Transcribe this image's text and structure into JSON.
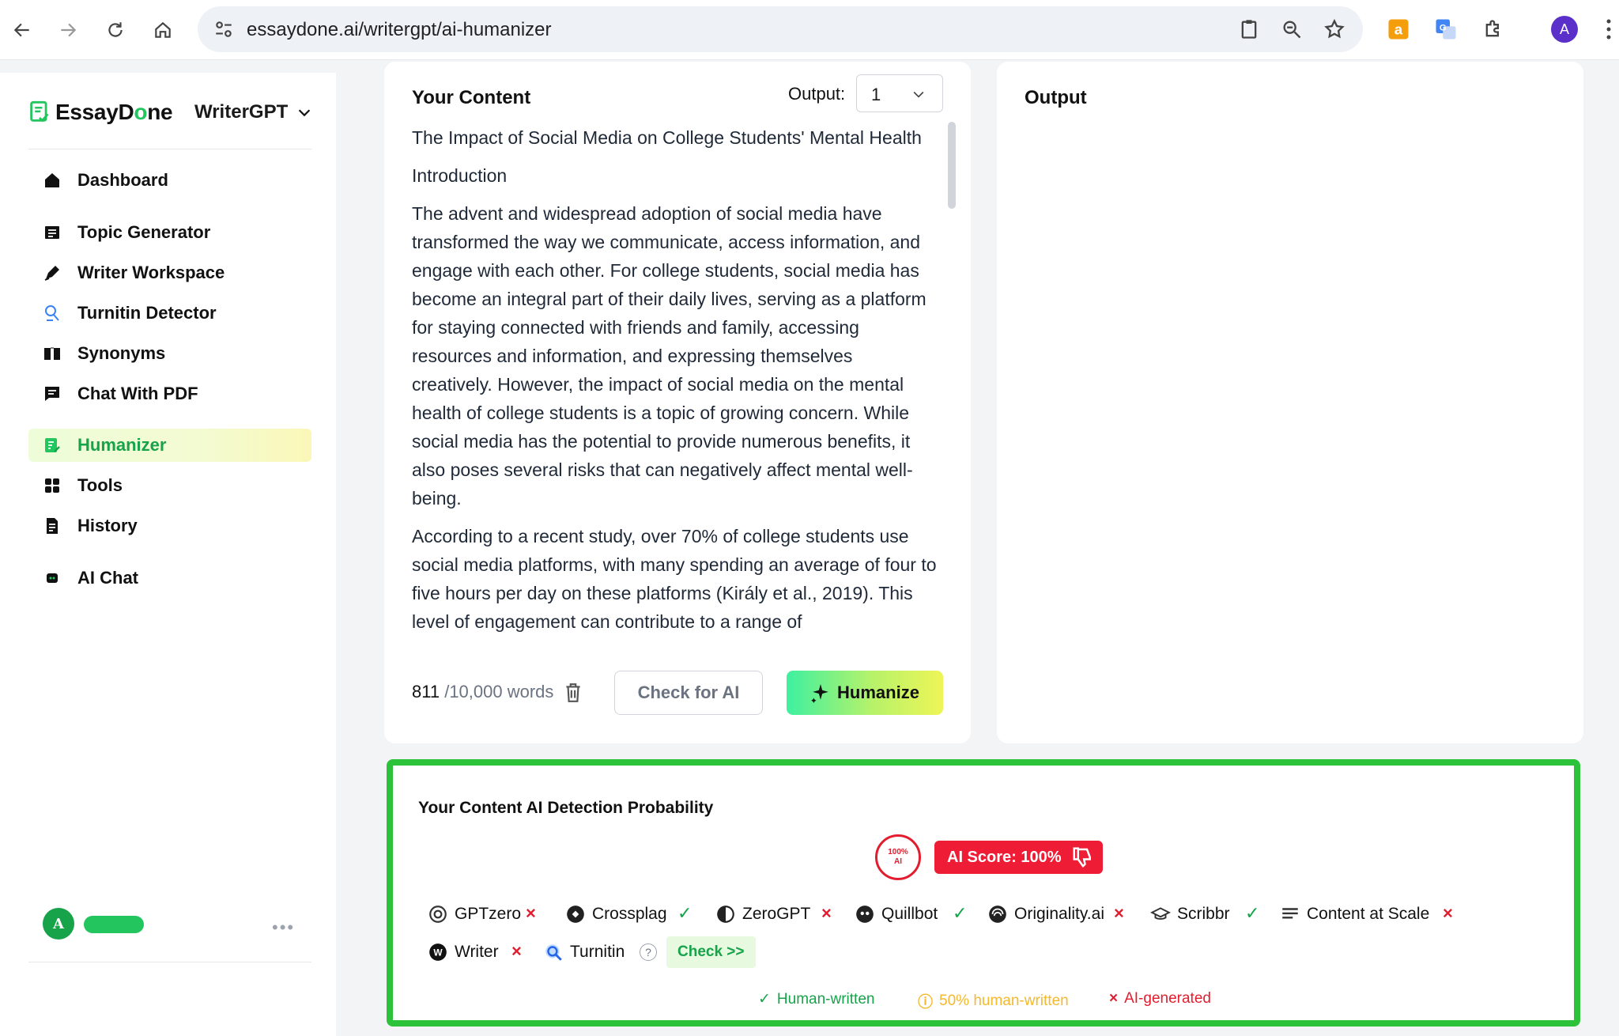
{
  "browser": {
    "url": "essaydone.ai/writergpt/ai-humanizer",
    "profile_initial": "A"
  },
  "sidebar": {
    "logo_prefix": "EssayD",
    "logo_o": "o",
    "logo_suffix": "ne",
    "product": "WriterGPT",
    "items": [
      {
        "label": "Dashboard",
        "icon": "home-icon"
      },
      {
        "label": "Topic Generator",
        "icon": "list-icon"
      },
      {
        "label": "Writer Workspace",
        "icon": "pen-icon"
      },
      {
        "label": "Turnitin Detector",
        "icon": "flask-icon"
      },
      {
        "label": "Synonyms",
        "icon": "book-icon"
      },
      {
        "label": "Chat With PDF",
        "icon": "chat-icon"
      },
      {
        "label": "Humanizer",
        "icon": "document-pen-icon"
      },
      {
        "label": "Tools",
        "icon": "grid-icon"
      },
      {
        "label": "History",
        "icon": "file-icon"
      },
      {
        "label": "AI Chat",
        "icon": "robot-icon"
      }
    ],
    "user_initial": "A",
    "more": "•••"
  },
  "editor": {
    "title": "Your Content",
    "output_label": "Output:",
    "output_value": "1",
    "paragraphs": [
      "The Impact of Social Media on College Students' Mental Health",
      "Introduction",
      "The advent and widespread adoption of social media have transformed the way we communicate, access information, and engage with each other. For college students, social media has become an integral part of their daily lives, serving as a platform for staying connected with friends and family, accessing resources and information, and expressing themselves creatively. However, the impact of social media on the mental health of college students is a topic of growing concern. While social media has the potential to provide numerous benefits, it also poses several risks that can negatively affect mental well-being.",
      "According to a recent study, over 70% of college students use social media platforms, with many spending an average of four to five hours per day on these platforms (Király et al., 2019). This level of engagement can contribute to a range of"
    ],
    "word_count": "811",
    "word_limit": "/10,000 words",
    "check_label": "Check for AI",
    "humanize_label": "Humanize"
  },
  "output_panel": {
    "title": "Output"
  },
  "detection": {
    "title": "Your Content AI Detection Probability",
    "ring_line1": "100%",
    "ring_line2": "AI",
    "score_label": "AI Score: 100%",
    "detectors_row1": [
      {
        "name": "GPTzero",
        "result": "×"
      },
      {
        "name": "Crossplag",
        "result": "✓"
      },
      {
        "name": "ZeroGPT",
        "result": "×"
      },
      {
        "name": "Quillbot",
        "result": "✓"
      },
      {
        "name": "Originality.ai",
        "result": "×"
      },
      {
        "name": "Scribbr",
        "result": "✓"
      },
      {
        "name": "Content at Scale",
        "result": "×"
      }
    ],
    "detectors_row2": [
      {
        "name": "Writer",
        "result": "×"
      },
      {
        "name": "Turnitin",
        "result": "?"
      }
    ],
    "check_link": "Check >>",
    "legend": {
      "human": "Human-written",
      "half": "50% human-written",
      "ai": "AI-generated"
    },
    "colors": {
      "human": "#16a34a",
      "half": "#f5b82e",
      "ai": "#e11d2e"
    }
  }
}
